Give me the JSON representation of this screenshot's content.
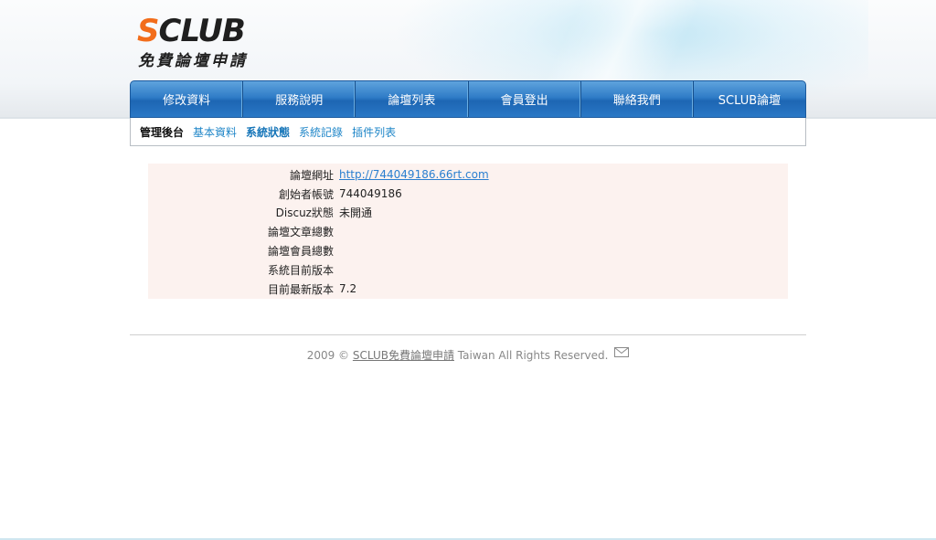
{
  "logo": {
    "brand_s": "S",
    "brand_rest": "CLUB",
    "subtitle": "免費論壇申請",
    "accent_color": "#f26d1b"
  },
  "nav": {
    "items": [
      {
        "label": "修改資料"
      },
      {
        "label": "服務說明"
      },
      {
        "label": "論壇列表"
      },
      {
        "label": "會員登出"
      },
      {
        "label": "聯絡我們"
      },
      {
        "label": "SCLUB論壇"
      }
    ]
  },
  "subnav": {
    "title": "管理後台",
    "links": [
      {
        "label": "基本資料",
        "active": false
      },
      {
        "label": "系統狀態",
        "active": true
      },
      {
        "label": "系統記錄",
        "active": false
      },
      {
        "label": "插件列表",
        "active": false
      }
    ]
  },
  "info": {
    "rows": [
      {
        "label": "論壇網址",
        "value": "http://744049186.66rt.com"
      },
      {
        "label": "創始者帳號",
        "value": "744049186"
      },
      {
        "label": "Discuz狀態",
        "value": "未開通"
      },
      {
        "label": "論壇文章總數",
        "value": ""
      },
      {
        "label": "論壇會員總數",
        "value": ""
      },
      {
        "label": "系統目前版本",
        "value": ""
      },
      {
        "label": "目前最新版本",
        "value": "7.2"
      }
    ]
  },
  "footer": {
    "prefix": "2009 © ",
    "link": "SCLUB免費論壇申請",
    "suffix": " Taiwan All Rights Reserved.",
    "mail_icon": "mail-icon"
  }
}
